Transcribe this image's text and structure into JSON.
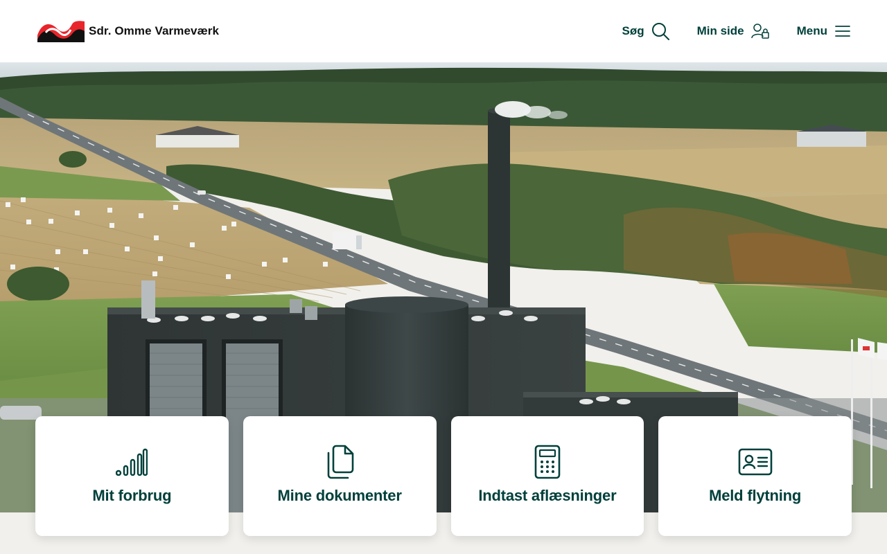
{
  "header": {
    "logo_text": "Sdr. Omme Varmeværk",
    "nav": {
      "search_label": "Søg",
      "my_page_label": "Min side",
      "menu_label": "Menu"
    }
  },
  "cards": [
    {
      "label": "Mit forbrug",
      "icon": "signal-bars-icon"
    },
    {
      "label": "Mine dokumenter",
      "icon": "documents-icon"
    },
    {
      "label": "Indtast aflæsninger",
      "icon": "calculator-icon"
    },
    {
      "label": "Meld flytning",
      "icon": "id-card-icon"
    }
  ],
  "colors": {
    "brand_dark": "#00403b",
    "logo_red": "#e8252b",
    "background": "#f1f0ec"
  }
}
